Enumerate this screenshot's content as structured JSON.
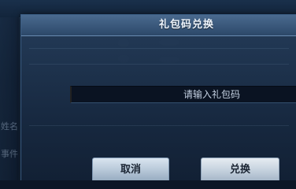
{
  "dialog": {
    "title": "礼包码兑换",
    "input_placeholder": "请输入礼包码",
    "input_value": "",
    "cancel_label": "取消",
    "confirm_label": "兑换"
  },
  "background": {
    "side_labels": [
      "姓名",
      "事件"
    ]
  },
  "colors": {
    "dialog_header": "#2c4869",
    "dialog_body": "#18283e",
    "button_light": "#c2cfdc"
  }
}
